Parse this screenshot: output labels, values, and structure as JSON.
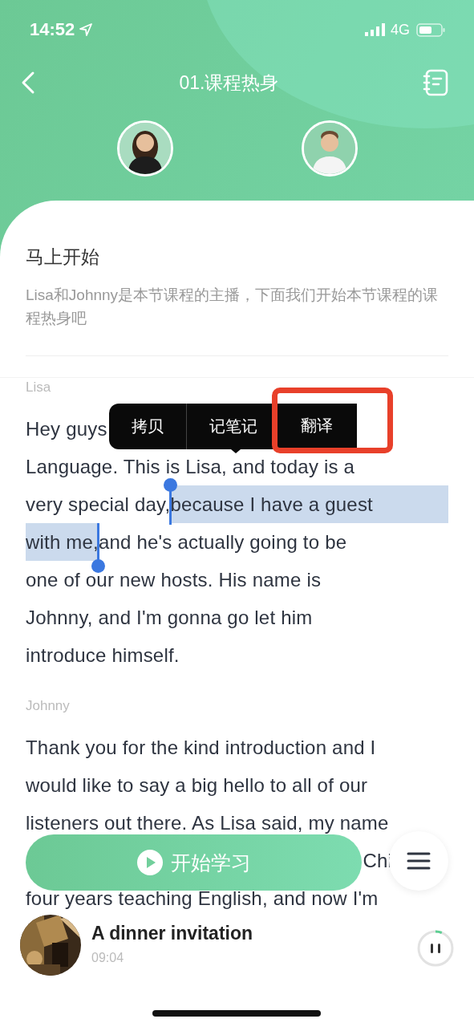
{
  "status_bar": {
    "time": "14:52",
    "network": "4G"
  },
  "nav": {
    "title": "01.课程热身"
  },
  "hosts": [
    {
      "kind": "woman"
    },
    {
      "kind": "man"
    }
  ],
  "intro": {
    "title": "马上开始",
    "description": "Lisa和Johnny是本节课程的主播，下面我们开始本节课程的课程热身吧"
  },
  "transcript": [
    {
      "speaker": "Lisa",
      "lines": [
        {
          "covered": false,
          "segments": [
            {
              "text": "Hey guys",
              "selected": false
            }
          ]
        },
        {
          "covered": false,
          "segments": [
            {
              "text": "Language. This is Lisa, and today is a",
              "selected": false
            }
          ]
        },
        {
          "covered": false,
          "segments": [
            {
              "text": "very special day, ",
              "selected": false
            },
            {
              "text": "because I have a guest",
              "selected": true
            }
          ]
        },
        {
          "covered": false,
          "segments": [
            {
              "text": "with me,",
              "selected": true
            },
            {
              "text": " and he's actually going to be",
              "selected": false
            }
          ]
        },
        {
          "covered": false,
          "segments": [
            {
              "text": "one of our new hosts. His name is",
              "selected": false
            }
          ]
        },
        {
          "covered": false,
          "segments": [
            {
              "text": "Johnny, and I'm gonna go let him",
              "selected": false
            }
          ]
        },
        {
          "covered": false,
          "segments": [
            {
              "text": "introduce himself.",
              "selected": false
            }
          ]
        }
      ]
    },
    {
      "speaker": "Johnny",
      "lines": [
        {
          "covered": false,
          "segments": [
            {
              "text": "Thank you for the kind introduction and I",
              "selected": false
            }
          ]
        },
        {
          "covered": false,
          "segments": [
            {
              "text": "would like to say a big hello to all of our",
              "selected": false
            }
          ]
        },
        {
          "covered": false,
          "segments": [
            {
              "text": "listeners out there. As Lisa said, my name",
              "selected": false
            }
          ]
        },
        {
          "covered": true,
          "segments": [
            {
              "text": "Chi",
              "selected": false
            }
          ]
        },
        {
          "covered": false,
          "segments": [
            {
              "text": "four years teaching English, and now I'm",
              "selected": false
            }
          ]
        }
      ]
    }
  ],
  "context_menu": {
    "items": [
      {
        "label": "拷贝",
        "marked": false
      },
      {
        "label": "记笔记",
        "marked": false
      },
      {
        "label": "翻译",
        "marked": true
      }
    ]
  },
  "start_button": {
    "label": "开始学习"
  },
  "player": {
    "title": "A dinner invitation",
    "time": "09:04",
    "level": 0.06
  }
}
